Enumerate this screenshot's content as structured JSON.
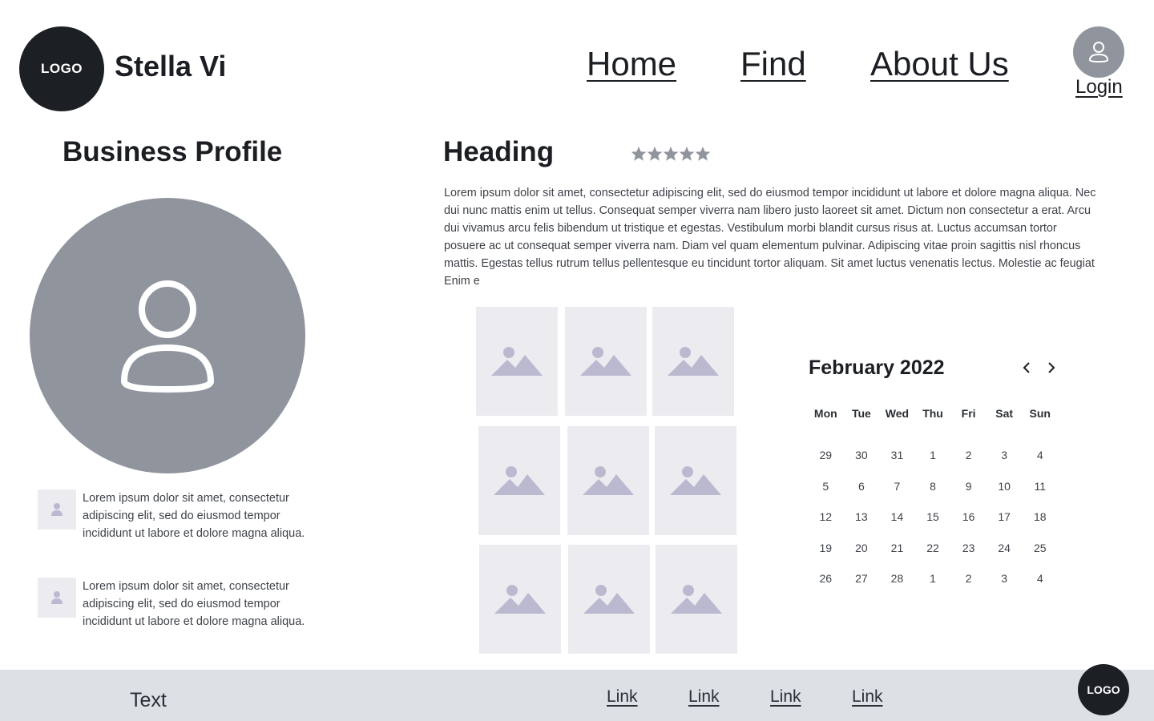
{
  "header": {
    "logo_text": "LOGO",
    "brand_name": "Stella Vi",
    "nav": [
      {
        "label": "Home"
      },
      {
        "label": "Find"
      },
      {
        "label": "About Us"
      }
    ],
    "login_label": "Login"
  },
  "sidebar": {
    "title": "Business Profile",
    "items": [
      {
        "text": "Lorem ipsum dolor sit amet, consectetur adipiscing elit, sed do eiusmod tempor incididunt ut labore et dolore magna aliqua."
      },
      {
        "text": "Lorem ipsum dolor sit amet, consectetur adipiscing elit, sed do eiusmod tempor incididunt ut labore et dolore magna aliqua."
      }
    ]
  },
  "main": {
    "heading": "Heading",
    "rating": {
      "value": 5,
      "max": 5
    },
    "paragraph": "Lorem ipsum dolor sit amet, consectetur adipiscing elit, sed do eiusmod tempor incididunt ut labore et dolore magna aliqua. Nec dui nunc mattis enim ut tellus. Consequat semper viverra nam libero justo laoreet sit amet. Dictum non consectetur a erat. Arcu dui vivamus arcu felis bibendum ut tristique et egestas. Vestibulum morbi blandit cursus risus at. Luctus accumsan tortor posuere ac ut consequat semper viverra nam. Diam vel quam elementum pulvinar. Adipiscing vitae proin sagittis nisl rhoncus mattis. Egestas tellus rutrum tellus pellentesque eu tincidunt tortor aliquam. Sit amet luctus venenatis lectus. Molestie ac feugiat Enim e"
  },
  "calendar": {
    "title": "February 2022",
    "weekdays": [
      "Mon",
      "Tue",
      "Wed",
      "Thu",
      "Fri",
      "Sat",
      "Sun"
    ],
    "weeks": [
      [
        "29",
        "30",
        "31",
        "1",
        "2",
        "3",
        "4"
      ],
      [
        "5",
        "6",
        "7",
        "8",
        "9",
        "10",
        "11"
      ],
      [
        "12",
        "13",
        "14",
        "15",
        "16",
        "17",
        "18"
      ],
      [
        "19",
        "20",
        "21",
        "22",
        "23",
        "24",
        "25"
      ],
      [
        "26",
        "27",
        "28",
        "1",
        "2",
        "3",
        "4"
      ]
    ]
  },
  "footer": {
    "text": "Text",
    "links": [
      {
        "label": "Link"
      },
      {
        "label": "Link"
      },
      {
        "label": "Link"
      },
      {
        "label": "Link"
      }
    ],
    "logo_text": "LOGO"
  },
  "colors": {
    "dark": "#1c1f24",
    "avatar_gray": "#8f949d",
    "placeholder_bg": "#ecebf0",
    "placeholder_icon": "#bbb9d0",
    "footer_bg": "#dde0e5"
  }
}
